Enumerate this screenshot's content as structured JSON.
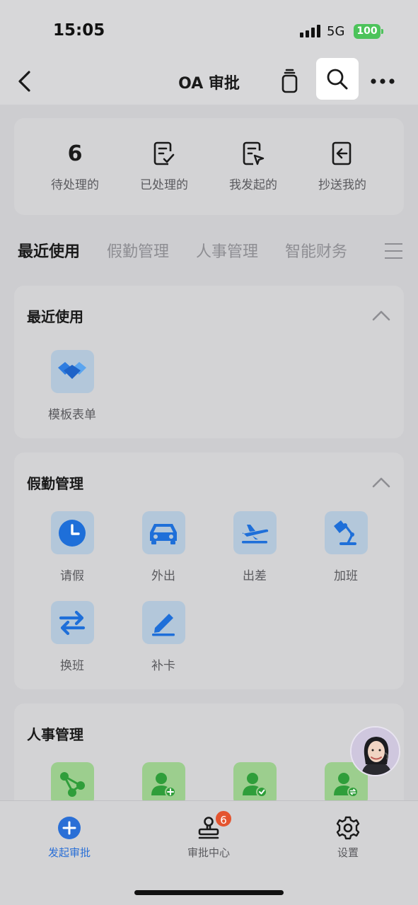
{
  "status_bar": {
    "time": "15:05",
    "network": "5G",
    "battery": "100"
  },
  "nav": {
    "title": "OA 审批",
    "back_icon": "chevron-left-icon",
    "copy_icon": "copy-icon",
    "search_icon": "search-icon",
    "more_icon": "more-horizontal-icon"
  },
  "stats": [
    {
      "count": "6",
      "label": "待处理的"
    },
    {
      "icon": "checklist-doc-icon",
      "label": "已处理的"
    },
    {
      "icon": "doc-send-icon",
      "label": "我发起的"
    },
    {
      "icon": "doc-inbox-icon",
      "label": "抄送我的"
    }
  ],
  "tabs": [
    {
      "label": "最近使用",
      "active": true
    },
    {
      "label": "假勤管理",
      "active": false
    },
    {
      "label": "人事管理",
      "active": false
    },
    {
      "label": "智能财务",
      "active": false
    }
  ],
  "sections": {
    "recent": {
      "title": "最近使用",
      "items": [
        {
          "label": "模板表单",
          "icon": "handshake-icon"
        }
      ]
    },
    "attendance": {
      "title": "假勤管理",
      "items": [
        {
          "label": "请假",
          "icon": "clock-icon"
        },
        {
          "label": "外出",
          "icon": "car-icon"
        },
        {
          "label": "出差",
          "icon": "plane-icon"
        },
        {
          "label": "加班",
          "icon": "desk-lamp-icon"
        },
        {
          "label": "换班",
          "icon": "swap-arrows-icon"
        },
        {
          "label": "补卡",
          "icon": "pen-icon"
        }
      ]
    },
    "hr": {
      "title": "人事管理",
      "items": [
        {
          "icon": "org-structure-icon"
        },
        {
          "icon": "user-add-icon"
        },
        {
          "icon": "user-check-icon"
        },
        {
          "icon": "user-transfer-icon"
        }
      ]
    }
  },
  "bottom_nav": [
    {
      "label": "发起审批",
      "icon": "plus-circle-icon",
      "active": true
    },
    {
      "label": "审批中心",
      "icon": "stamp-icon",
      "badge": "6",
      "active": false
    },
    {
      "label": "设置",
      "icon": "gear-icon",
      "active": false
    }
  ],
  "colors": {
    "accent": "#2a6fd6",
    "badge": "#e4542f",
    "battery": "#4cc35a",
    "tile_blue": "#b3c7da",
    "tile_green": "#9cce8e"
  }
}
